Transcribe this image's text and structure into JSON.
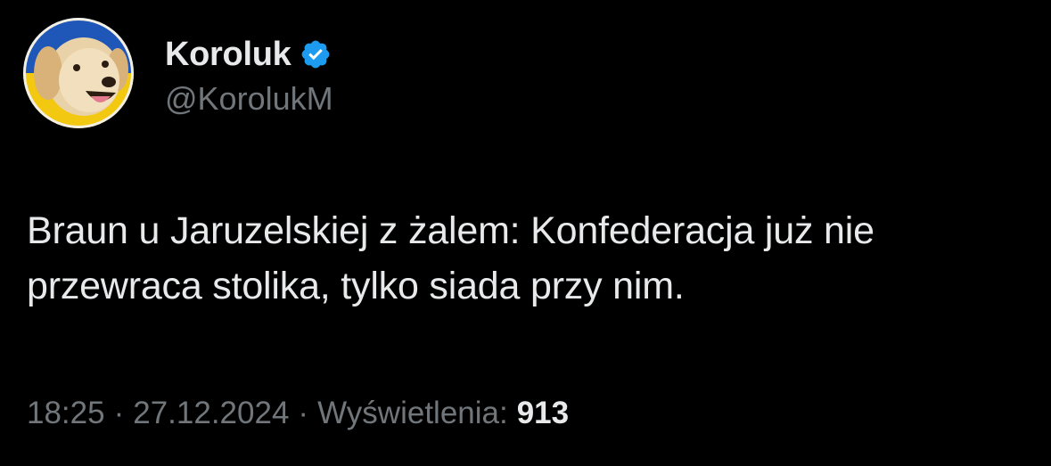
{
  "author": {
    "display_name": "Koroluk",
    "handle": "@KorolukM",
    "verified_icon": "verified-badge-icon",
    "avatar_icon": "dog-avatar"
  },
  "tweet": {
    "text": "Braun u Jaruzelskiej z żalem: Konfederacja już nie przewraca stolika, tylko siada przy nim."
  },
  "meta": {
    "time": "18:25",
    "separator": "·",
    "date": "27.12.2024",
    "views_label": "Wyświetlenia:",
    "views_count": "913"
  },
  "colors": {
    "background": "#000000",
    "primary_text": "#e7e9ea",
    "secondary_text": "#71767b",
    "verified_blue": "#1d9bf0",
    "flag_blue": "#1f57b8",
    "flag_yellow": "#f2c811"
  }
}
